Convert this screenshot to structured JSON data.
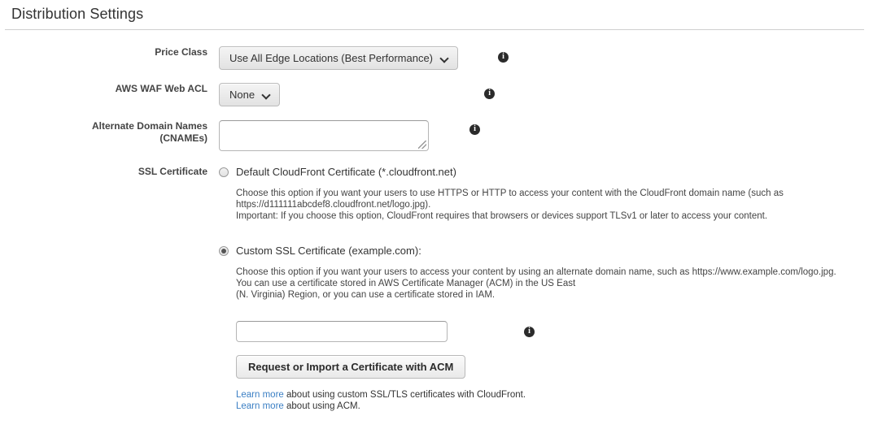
{
  "header": {
    "title": "Distribution Settings"
  },
  "form": {
    "price_class": {
      "label": "Price Class",
      "value": "Use All Edge Locations (Best Performance)",
      "chevron_icon": "chevron-down-icon",
      "info_icon": "info-icon",
      "info_glyph": "i"
    },
    "waf_acl": {
      "label": "AWS WAF Web ACL",
      "value": "None",
      "chevron_icon": "chevron-down-icon",
      "info_icon": "info-icon",
      "info_glyph": "i"
    },
    "cnames": {
      "label_line1": "Alternate Domain Names",
      "label_line2": "(CNAMEs)",
      "value": "",
      "placeholder": "",
      "info_icon": "info-icon",
      "info_glyph": "i"
    },
    "ssl_certificate": {
      "label": "SSL Certificate",
      "options": [
        {
          "id": "default-cloudfront-certificate",
          "label": "Default CloudFront Certificate (*.cloudfront.net)",
          "selected": false,
          "description": [
            "Choose this option if you want your users to use HTTPS or HTTP to access your content with the CloudFront domain name (such as",
            "https://d111111abcdef8.cloudfront.net/logo.jpg).",
            "Important: If you choose this option, CloudFront requires that browsers or devices support TLSv1 or later to access your content."
          ]
        },
        {
          "id": "custom-ssl-certificate",
          "label": "Custom SSL Certificate (example.com):",
          "selected": true,
          "description": [
            "Choose this option if you want your users to access your content by using an alternate domain name, such as https://www.example.com/logo.jpg.",
            "You can use a certificate stored in AWS Certificate Manager (ACM) in the US East",
            "(N. Virginia) Region, or you can use a certificate stored in IAM."
          ]
        }
      ],
      "certificate_input": {
        "value": "",
        "placeholder": "",
        "info_icon": "info-icon",
        "info_glyph": "i"
      },
      "acm_button": "Request or Import a Certificate with ACM",
      "links": [
        {
          "link_text": "Learn more",
          "rest_text": " about using custom SSL/TLS certificates with CloudFront."
        },
        {
          "link_text": "Learn more",
          "rest_text": " about using ACM."
        }
      ]
    }
  },
  "colors": {
    "link": "#3b7fc4",
    "text": "#333333",
    "label": "#444444",
    "divider": "#cfcfcf"
  }
}
